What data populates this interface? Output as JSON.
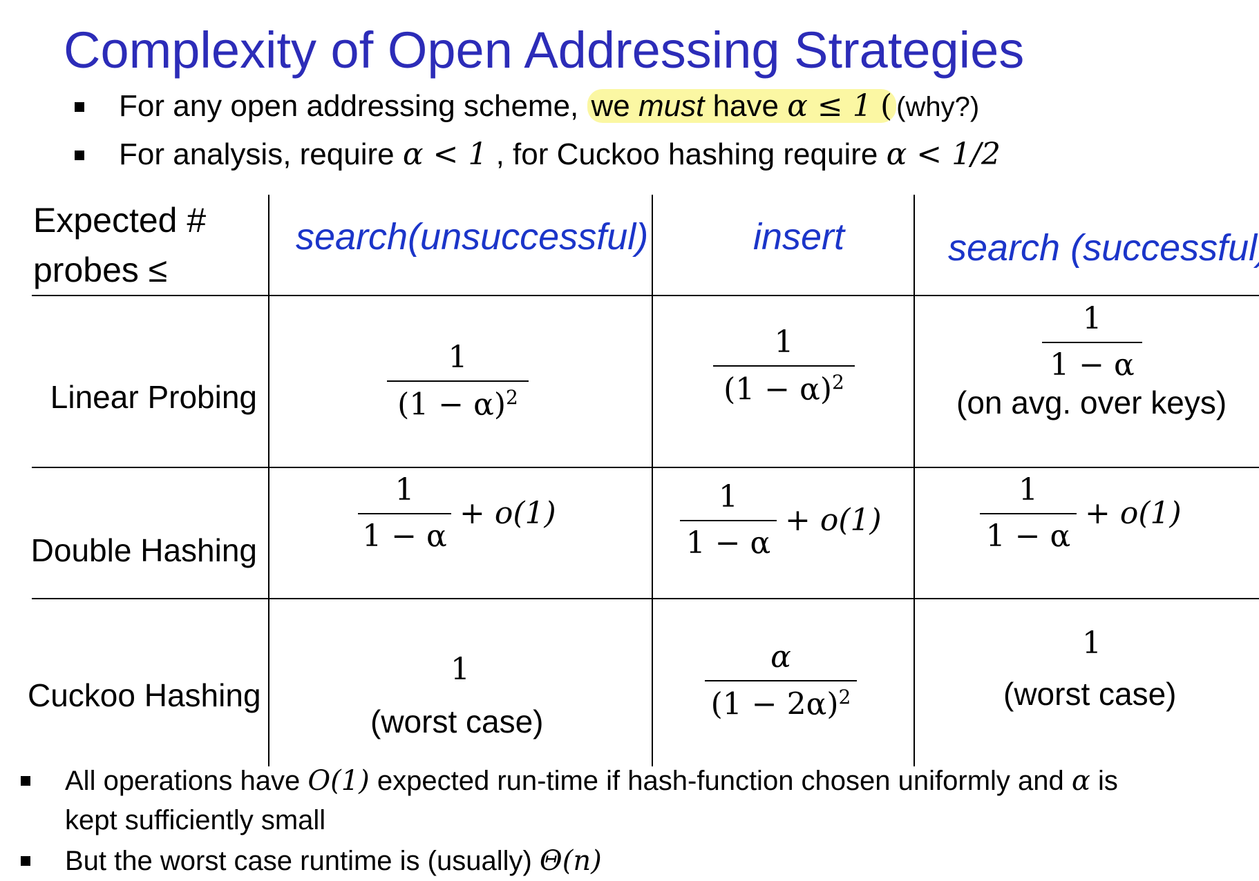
{
  "title": "Complexity of Open Addressing Strategies",
  "bullets_top": [
    {
      "prefix": "For any open addressing scheme, ",
      "highlight_a": "we ",
      "highlight_b": "must",
      "highlight_c": " have ",
      "math": "α ≤ 1",
      "suffix": "(why?)"
    },
    {
      "prefix": "For analysis, require ",
      "math1": "α < 1",
      "mid": " , for Cuckoo hashing require ",
      "math2": "α < 1/2"
    }
  ],
  "table": {
    "corner_line1": "Expected #",
    "corner_line2": "probes ≤",
    "columns": [
      "search(unsuccessful)",
      "insert",
      "search (successful)"
    ],
    "rows": [
      {
        "label": "Linear Probing",
        "c1": {
          "num": "1",
          "den": "(1 − α)",
          "exp": "2"
        },
        "c2": {
          "num": "1",
          "den": "(1 − α)",
          "exp": "2"
        },
        "c3": {
          "num": "1",
          "den": "1 − α",
          "note": "(on avg. over keys)"
        }
      },
      {
        "label": "Double Hashing",
        "c1": {
          "num": "1",
          "den": "1 − α",
          "tail": "+ o(1)"
        },
        "c2": {
          "num": "1",
          "den": "1 − α",
          "tail": "+ o(1)"
        },
        "c3": {
          "num": "1",
          "den": "1 − α",
          "tail": "+ o(1)"
        }
      },
      {
        "label": "Cuckoo Hashing",
        "c1": {
          "value": "1",
          "note": "(worst case)"
        },
        "c2": {
          "num": "α",
          "den": "(1 − 2α)",
          "exp": "2"
        },
        "c3": {
          "value": "1",
          "note": "(worst case)"
        }
      }
    ]
  },
  "bullets_bottom": [
    {
      "prefix": "All operations have ",
      "math": "O(1)",
      "mid": " expected run-time if  hash-function chosen uniformly and ",
      "math2": "α",
      "suffix": " is",
      "line2": "kept sufficiently small"
    },
    {
      "prefix": "But the worst case runtime is (usually) ",
      "math": "Θ(n)"
    }
  ],
  "colors": {
    "title": "#2c2cb8",
    "column_header": "#1b35c9",
    "highlight": "#fbf7a3"
  }
}
